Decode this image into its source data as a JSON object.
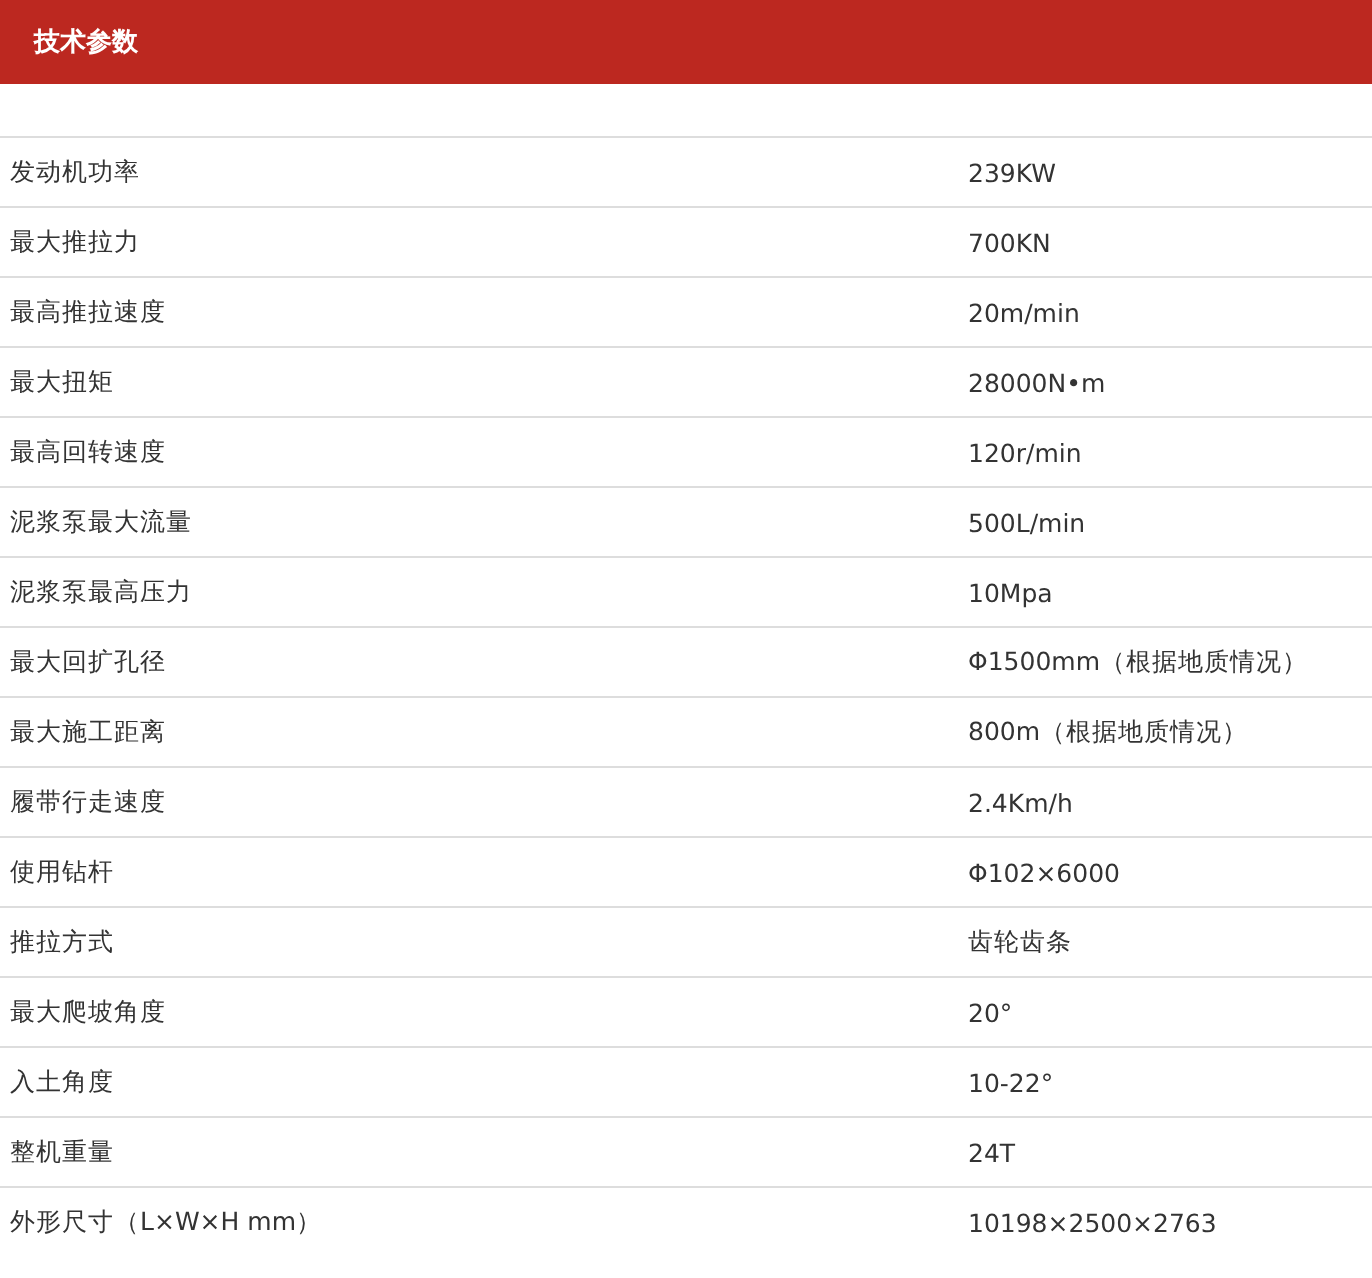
{
  "header": {
    "title": "技术参数"
  },
  "rows": [
    {
      "name": "发动机功率",
      "value": "239KW"
    },
    {
      "name": "最大推拉力",
      "value": "700KN"
    },
    {
      "name": "最高推拉速度",
      "value": "20m/min"
    },
    {
      "name": "最大扭矩",
      "value": "28000N•m"
    },
    {
      "name": "最高回转速度",
      "value": "120r/min"
    },
    {
      "name": "泥浆泵最大流量",
      "value": "500L/min"
    },
    {
      "name": "泥浆泵最高压力",
      "value": "10Mpa"
    },
    {
      "name": "最大回扩孔径",
      "value": "Φ1500mm（根据地质情况）"
    },
    {
      "name": "最大施工距离",
      "value": "800m（根据地质情况）"
    },
    {
      "name": "履带行走速度",
      "value": "2.4Km/h"
    },
    {
      "name": "使用钻杆",
      "value": "Φ102×6000"
    },
    {
      "name": "推拉方式",
      "value": "齿轮齿条"
    },
    {
      "name": "最大爬坡角度",
      "value": "20°"
    },
    {
      "name": "入土角度",
      "value": "10-22°"
    },
    {
      "name": "整机重量",
      "value": "24T"
    },
    {
      "name": "外形尺寸（L×W×H mm）",
      "value": "10198×2500×2763"
    }
  ]
}
